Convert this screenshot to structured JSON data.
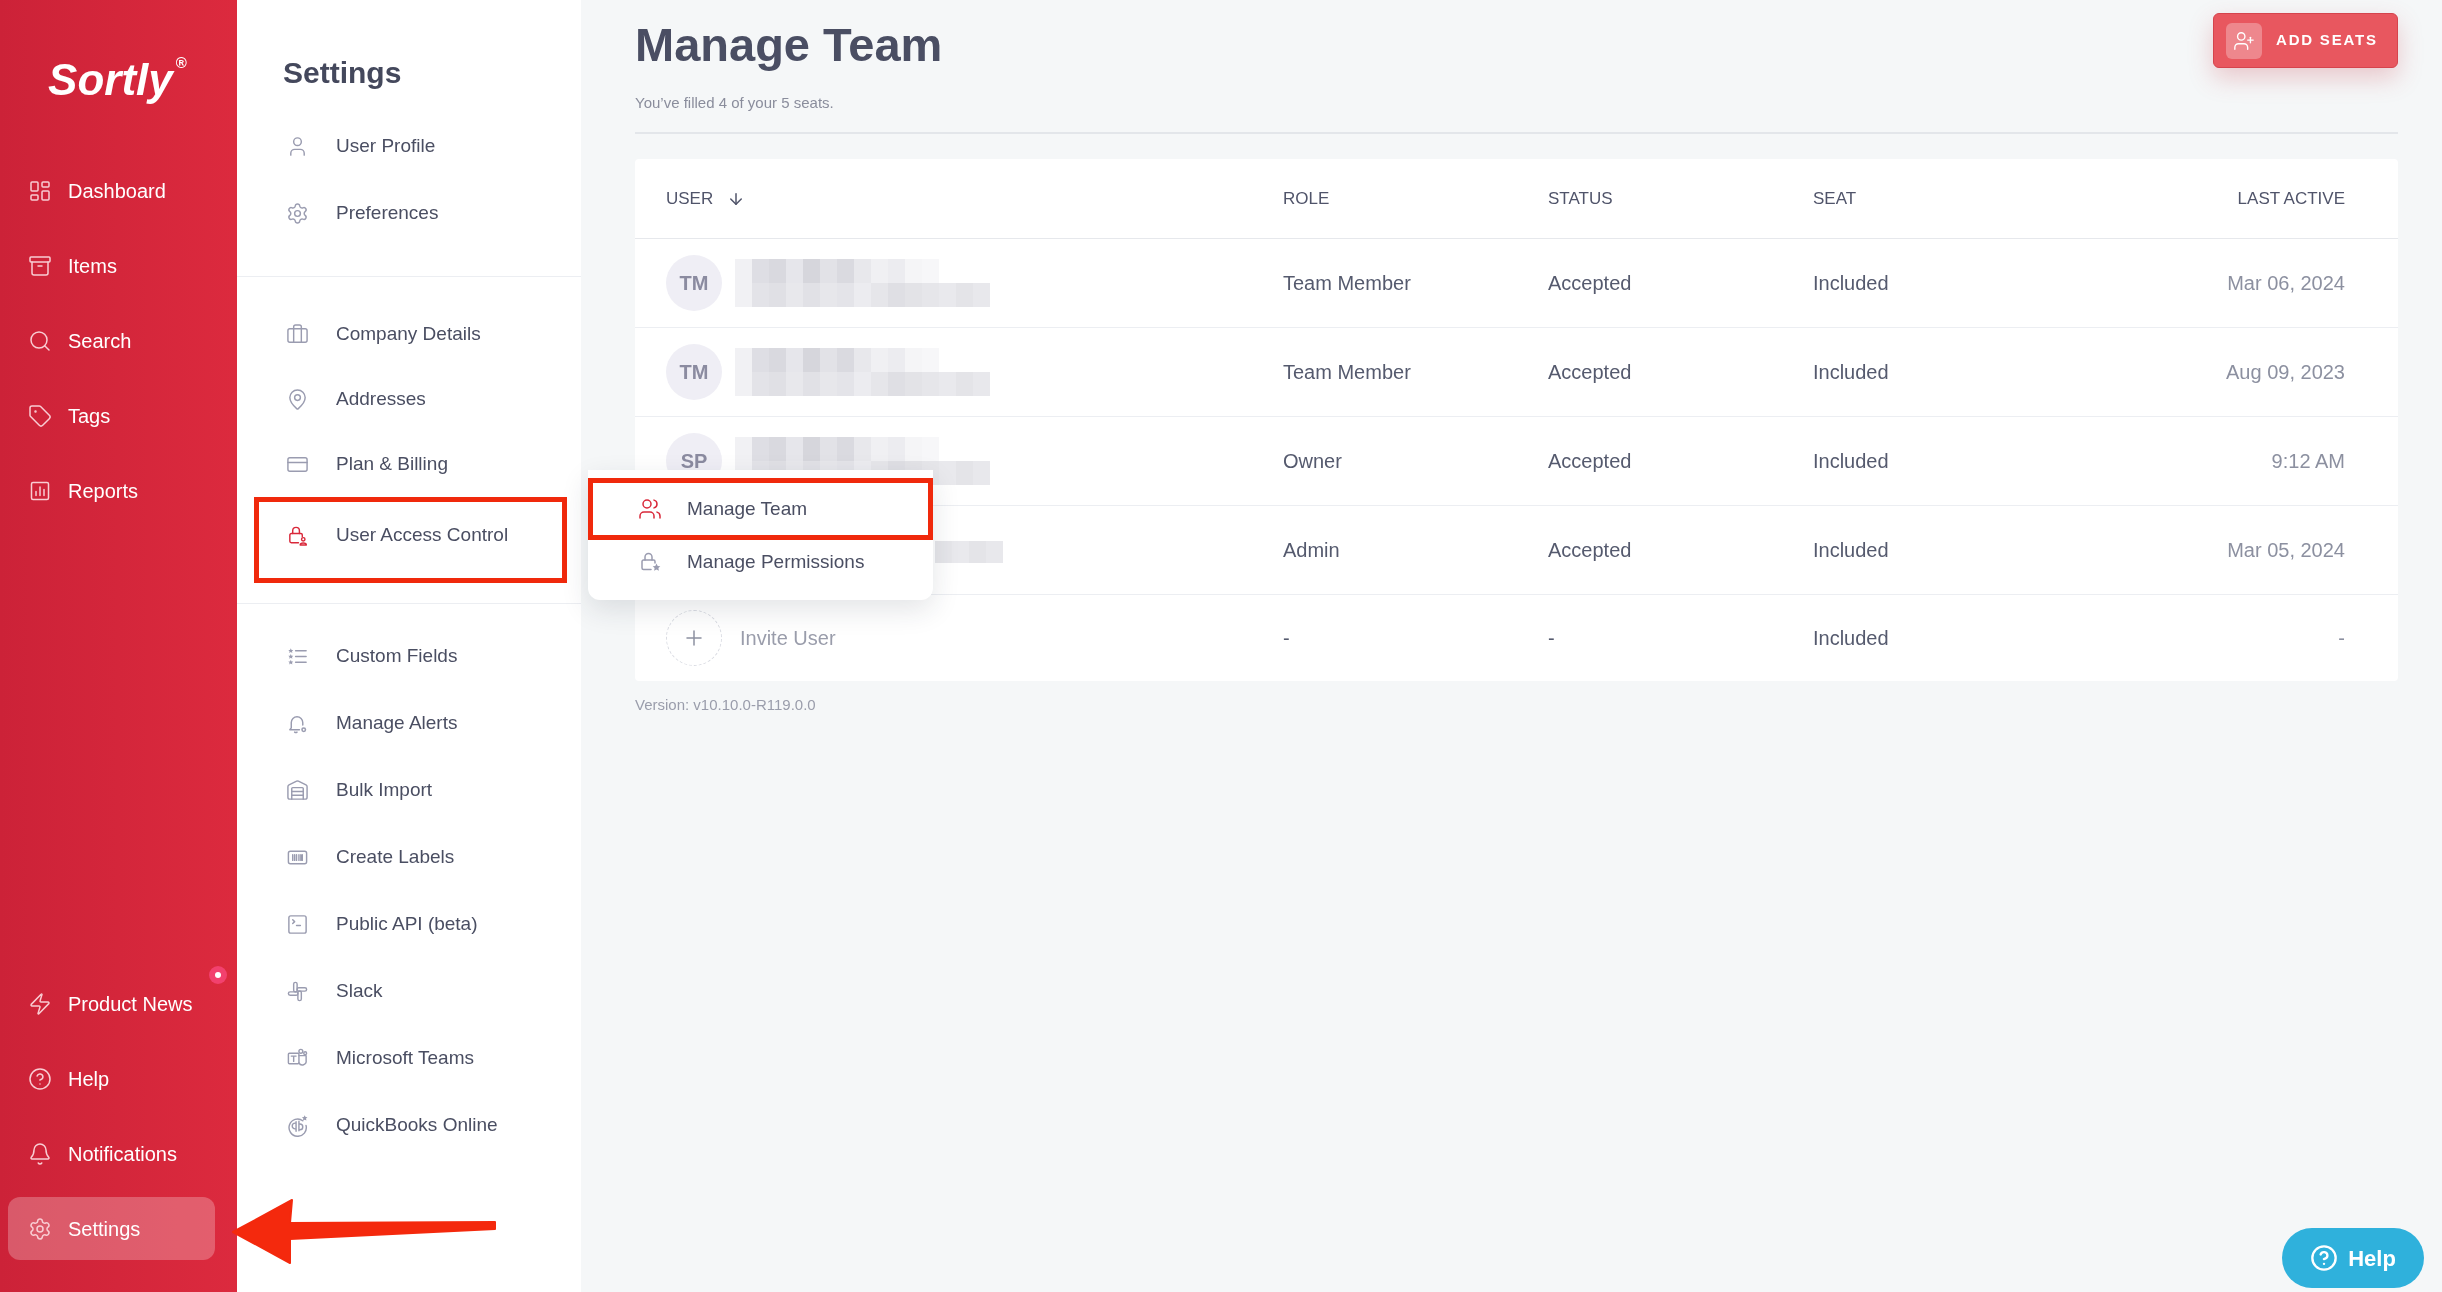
{
  "sidebar": {
    "logo": "Sortly$^{®}$",
    "nav_top": [
      {
        "label": "Dashboard",
        "selected": false
      },
      {
        "label": "Items",
        "selected": false
      },
      {
        "label": "Search",
        "selected": false
      },
      {
        "label": "Tags",
        "selected": false
      },
      {
        "label": "Reports",
        "selected": false
      }
    ],
    "nav_bottom": [
      {
        "label": "Product News",
        "selected": false,
        "unread": true
      },
      {
        "label": "Help",
        "selected": false,
        "unread": false
      },
      {
        "label": "Notifications",
        "selected": false,
        "unread": false
      },
      {
        "label": "Settings",
        "selected": true,
        "unread": false
      }
    ]
  },
  "settings_panel": {
    "title": "Settings",
    "sections": [
      {
        "items": [
          {
            "label": "User Profile",
            "selected": false
          },
          {
            "label": "Preferences",
            "selected": false
          }
        ]
      },
      {
        "items": [
          {
            "label": "Company Details",
            "selected": false
          },
          {
            "label": "Addresses",
            "selected": false
          },
          {
            "label": "Plan & Billing",
            "selected": false
          },
          {
            "label": "User Access Control",
            "selected": true
          }
        ]
      },
      {
        "items": [
          {
            "label": "Custom Fields",
            "selected": false
          },
          {
            "label": "Manage Alerts",
            "selected": false
          },
          {
            "label": "Bulk Import",
            "selected": false
          },
          {
            "label": "Create Labels",
            "selected": false
          },
          {
            "label": "Public API (beta)",
            "selected": false
          },
          {
            "label": "Slack",
            "selected": false
          },
          {
            "label": "Microsoft Teams",
            "selected": false
          },
          {
            "label": "QuickBooks Online",
            "selected": false
          }
        ]
      }
    ]
  },
  "page": {
    "title": "Manage Team",
    "subtitle": "You’ve filled 4 of your 5 seats.",
    "add_button": "ADD SEATS"
  },
  "table": {
    "columns": [
      {
        "label": "USER",
        "sorted": true
      },
      {
        "label": "ROLE",
        "sorted": false
      },
      {
        "label": "STATUS",
        "sorted": false
      },
      {
        "label": "SEAT",
        "sorted": false
      },
      {
        "label": "LAST ACTIVE",
        "sorted": false
      }
    ],
    "rows": [
      {
        "initials": "TM",
        "role": "Team Member",
        "status": "Accepted",
        "seat": "Included",
        "last_active": "Mar 06, 2024"
      },
      {
        "initials": "TM",
        "role": "Team Member",
        "status": "Accepted",
        "seat": "Included",
        "last_active": "Aug 09, 2023"
      },
      {
        "initials": "SP",
        "role": "Owner",
        "status": "Accepted",
        "seat": "Included",
        "last_active": "9:12 AM"
      },
      {
        "role": "Admin",
        "status": "Accepted",
        "seat": "Included",
        "last_active": "Mar 05, 2024"
      }
    ],
    "invite_row": {
      "label": "Invite User",
      "role": "-",
      "status": "-",
      "seat": "Included",
      "last_active": "-"
    }
  },
  "version": "Version: v10.10.0-R119.0.0",
  "flyout_menu": {
    "items": [
      {
        "label": "Manage Team",
        "selected": true
      },
      {
        "label": "Manage Permissions",
        "selected": false
      }
    ]
  },
  "help_button": "Help"
}
